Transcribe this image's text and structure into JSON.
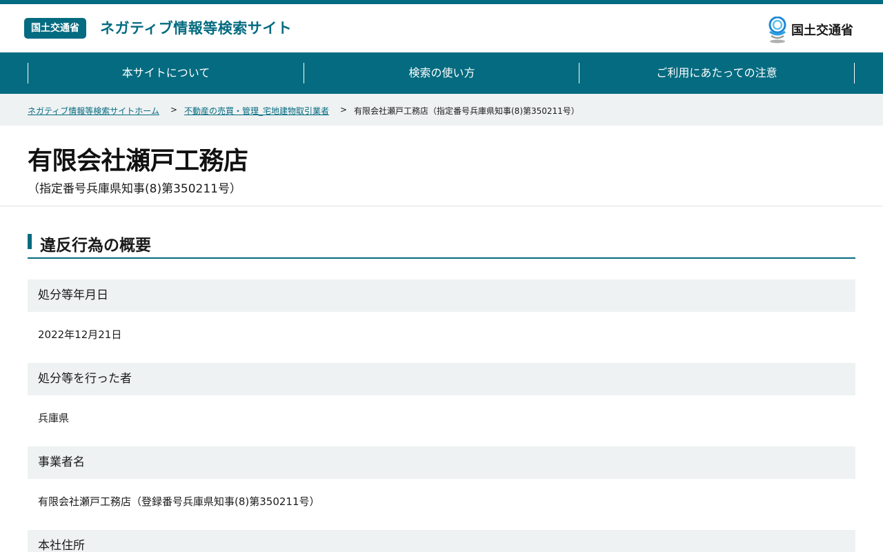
{
  "header": {
    "badge": "国土交通省",
    "site_title": "ネガティブ情報等検索サイト",
    "ministry_logo": {
      "icon": "mlit-emblem-icon",
      "name": "国土交通省"
    }
  },
  "nav": {
    "items": [
      {
        "label": "本サイトについて"
      },
      {
        "label": "検索の使い方"
      },
      {
        "label": "ご利用にあたっての注意"
      }
    ]
  },
  "breadcrumb": {
    "home": "ネガティブ情報等検索サイトホーム",
    "sep1": ">",
    "category": "不動産の売買・管理_宅地建物取引業者",
    "sep2": ">",
    "current": "有限会社瀬戸工務店（指定番号兵庫県知事(8)第350211号）"
  },
  "page": {
    "title": "有限会社瀬戸工務店",
    "subtitle": "（指定番号兵庫県知事(8)第350211号）"
  },
  "section": {
    "heading": "違反行為の概要",
    "fields": [
      {
        "label": "処分等年月日",
        "value": "2022年12月21日"
      },
      {
        "label": "処分等を行った者",
        "value": "兵庫県"
      },
      {
        "label": "事業者名",
        "value": "有限会社瀬戸工務店（登録番号兵庫県知事(8)第350211号）"
      },
      {
        "label": "本社住所",
        "value": ""
      }
    ]
  },
  "colors": {
    "brand": "#046b80",
    "label_bg": "#eff2f3"
  }
}
